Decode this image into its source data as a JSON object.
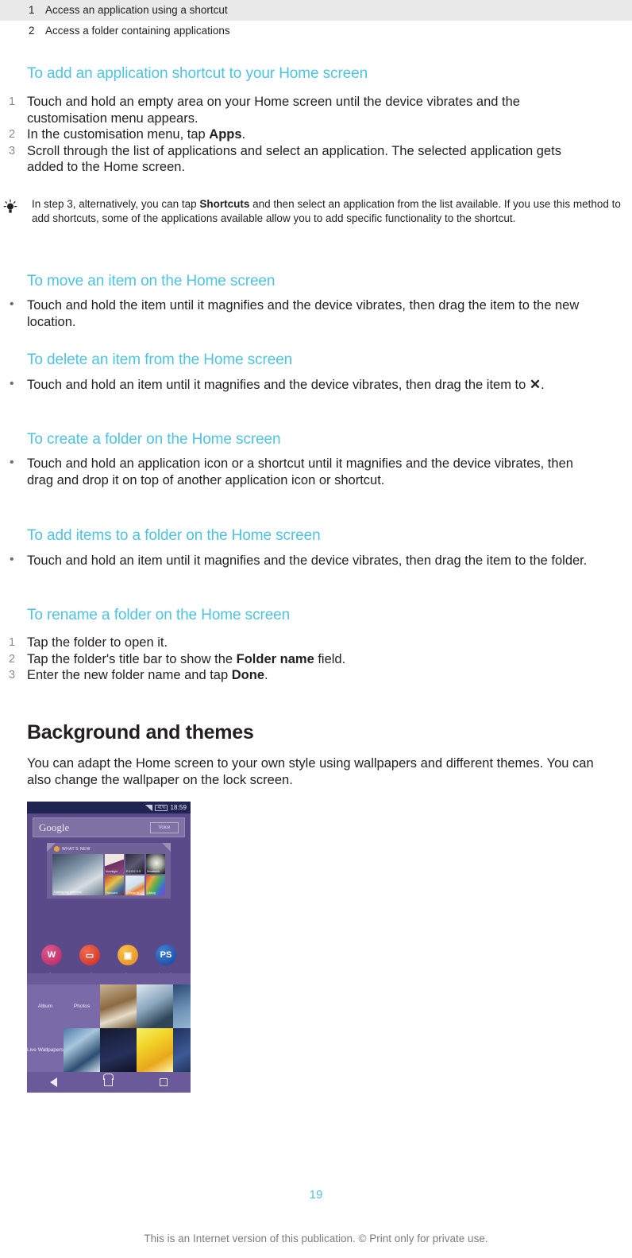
{
  "legend_table": {
    "rows": [
      {
        "num": "1",
        "text": "Access an application using a shortcut",
        "shaded": true
      },
      {
        "num": "2",
        "text": "Access a folder containing applications",
        "shaded": false
      }
    ]
  },
  "sections": [
    {
      "heading": "To add an application shortcut to your Home screen",
      "list_type": "ordered",
      "items": [
        {
          "marker": "1",
          "html": "Touch and hold an empty area on your Home screen until the device vibrates and the customisation menu appears."
        },
        {
          "marker": "2",
          "html": "In the customisation menu, tap <b>Apps</b>."
        },
        {
          "marker": "3",
          "html": "Scroll through the list of applications and select an application. The selected application gets added to the Home screen."
        }
      ]
    },
    {
      "heading": "To move an item on the Home screen",
      "list_type": "bulleted",
      "items": [
        {
          "marker": "•",
          "html": "Touch and hold the item until it magnifies and the device vibrates, then drag the item to the new location."
        }
      ]
    },
    {
      "heading": "To delete an item from the Home screen",
      "list_type": "bulleted",
      "items": [
        {
          "marker": "•",
          "html": "Touch and hold an item until it magnifies and the device vibrates, then drag the item to <span class=\"x-glyph\">✕</span>."
        }
      ]
    },
    {
      "heading": "To create a folder on the Home screen",
      "list_type": "bulleted",
      "items": [
        {
          "marker": "•",
          "html": "Touch and hold an application icon or a shortcut until it magnifies and the device vibrates, then drag and drop it on top of another application icon or shortcut."
        }
      ]
    },
    {
      "heading": "To add items to a folder on the Home screen",
      "list_type": "bulleted",
      "items": [
        {
          "marker": "•",
          "html": "Touch and hold an item until it magnifies and the device vibrates, then drag the item to the folder."
        }
      ]
    },
    {
      "heading": "To rename a folder on the Home screen",
      "list_type": "ordered",
      "items": [
        {
          "marker": "1",
          "html": "Tap the folder to open it."
        },
        {
          "marker": "2",
          "html": "Tap the folder's title bar to show the <b>Folder name</b> field."
        },
        {
          "marker": "3",
          "html": "Enter the new folder name and tap <b>Done</b>."
        }
      ]
    }
  ],
  "tip": {
    "icon": "lightbulb-icon",
    "html": "In step 3, alternatively, you can tap <b>Shortcuts</b> and then select an application from the list available. If you use this method to add shortcuts, some of the applications available allow you to add specific functionality to the shortcut."
  },
  "chapter": {
    "title": "Background and themes",
    "intro": "You can adapt the Home screen to your own style using wallpapers and different themes. You can also change the wallpaper on the lock screen."
  },
  "phone_screenshot": {
    "status_bar": {
      "time": "18:59",
      "battery": "41%"
    },
    "search_bar": {
      "brand": "Google",
      "voice_label": "Voice"
    },
    "widget": {
      "title": "WHAT'S NEW"
    },
    "widget_tiles": [
      {
        "caption": "Calling my girlfriend"
      },
      {
        "caption": "Moonlight"
      },
      {
        "caption": "P.U.R.E.S.S."
      },
      {
        "caption": "Snowberth"
      },
      {
        "caption": "Overused"
      },
      {
        "caption": "A Piece Of"
      },
      {
        "caption": "Lifeluig"
      }
    ],
    "app_icons": [
      {
        "label": "Walkman",
        "glyph": "W"
      },
      {
        "label": "Movies",
        "glyph": "▭"
      },
      {
        "label": "Album",
        "glyph": "▣"
      },
      {
        "label": "PlayStation",
        "glyph": "PS"
      }
    ],
    "wallpaper_picker": {
      "options": [
        "Album",
        "Photos",
        "Live Wallpapers"
      ]
    },
    "nav_bar": {
      "back": "back-button",
      "home": "home-button",
      "recents": "recents-button"
    }
  },
  "footer": {
    "page_number": "19",
    "note": "This is an Internet version of this publication. © Print only for private use."
  },
  "colors": {
    "heading_cyan": "#4ec3e0",
    "body_text": "#231f20",
    "marker_gray": "#8a8a8a",
    "row_shade": "#e9e9e9",
    "footer_gray": "#7d7d7d"
  }
}
